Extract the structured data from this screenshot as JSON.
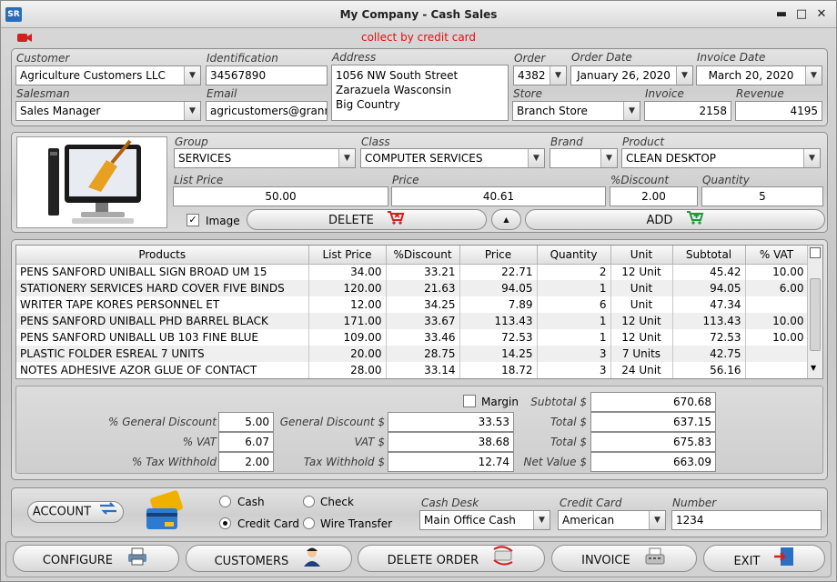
{
  "window": {
    "title": "My Company - Cash Sales",
    "logo_text": "SR",
    "min_glyph": "▬",
    "max_glyph": "□",
    "close_glyph": "✕"
  },
  "header": {
    "notice": "collect by credit card"
  },
  "customer": {
    "customer_label": "Customer",
    "customer_value": "Agriculture Customers LLC",
    "identification_label": "Identification",
    "identification_value": "34567890",
    "address_label": "Address",
    "address_lines": [
      "1056 NW South Street",
      "Zarazuela Wasconsin",
      "Big Country"
    ],
    "order_label": "Order",
    "order_value": "4382",
    "order_date_label": "Order Date",
    "order_date_value": "January 26, 2020",
    "invoice_date_label": "Invoice Date",
    "invoice_date_value": "March 20, 2020",
    "salesman_label": "Salesman",
    "salesman_value": "Sales Manager",
    "email_label": "Email",
    "email_value": "agricustomers@granm",
    "store_label": "Store",
    "store_value": "Branch Store",
    "invoice_label": "Invoice",
    "invoice_value": "2158",
    "revenue_label": "Revenue",
    "revenue_value": "4195"
  },
  "product": {
    "group_label": "Group",
    "group_value": "SERVICES",
    "class_label": "Class",
    "class_value": "COMPUTER SERVICES",
    "brand_label": "Brand",
    "brand_value": "",
    "product_label": "Product",
    "product_value": "CLEAN DESKTOP",
    "list_price_label": "List Price",
    "list_price_value": "50.00",
    "price_label": "Price",
    "price_value": "40.61",
    "discount_label": "%Discount",
    "discount_value": "2.00",
    "quantity_label": "Quantity",
    "quantity_value": "5",
    "image_checkbox_label": "Image",
    "image_checked": "✓",
    "delete_label": "DELETE",
    "up_glyph": "▲",
    "add_label": "ADD"
  },
  "grid": {
    "columns": [
      "Products",
      "List Price",
      "%Discount",
      "Price",
      "Quantity",
      "Unit",
      "Subtotal",
      "% VAT"
    ],
    "rows": [
      [
        "PENS SANFORD UNIBALL SIGN BROAD UM 15",
        "34.00",
        "33.21",
        "22.71",
        "2",
        "12 Unit",
        "45.42",
        "10.00"
      ],
      [
        "STATIONERY SERVICES HARD COVER FIVE BINDS",
        "120.00",
        "21.63",
        "94.05",
        "1",
        "Unit",
        "94.05",
        "6.00"
      ],
      [
        "WRITER TAPE KORES PERSONNEL ET",
        "12.00",
        "34.25",
        "7.89",
        "6",
        "Unit",
        "47.34",
        ""
      ],
      [
        "PENS SANFORD UNIBALL PHD BARREL BLACK",
        "171.00",
        "33.67",
        "113.43",
        "1",
        "12 Unit",
        "113.43",
        "10.00"
      ],
      [
        "PENS SANFORD UNIBALL UB 103 FINE BLUE",
        "109.00",
        "33.46",
        "72.53",
        "1",
        "12 Unit",
        "72.53",
        "10.00"
      ],
      [
        "PLASTIC FOLDER ESREAL 7 UNITS",
        "20.00",
        "28.75",
        "14.25",
        "3",
        "7 Units",
        "42.75",
        ""
      ],
      [
        "NOTES ADHESIVE AZOR GLUE OF CONTACT",
        "28.00",
        "33.14",
        "18.72",
        "3",
        "24 Unit",
        "56.16",
        ""
      ]
    ]
  },
  "totals": {
    "margin_label": "Margin",
    "general_discount_pct_label": "% General Discount",
    "general_discount_pct_value": "5.00",
    "vat_pct_label": "% VAT",
    "vat_pct_value": "6.07",
    "tax_withhold_pct_label": "% Tax Withhold",
    "tax_withhold_pct_value": "2.00",
    "general_discount_amt_label": "General Discount $",
    "general_discount_amt_value": "33.53",
    "vat_amt_label": "VAT $",
    "vat_amt_value": "38.68",
    "tax_withhold_amt_label": "Tax Withhold $",
    "tax_withhold_amt_value": "12.74",
    "subtotal_label": "Subtotal $",
    "subtotal_value": "670.68",
    "total1_label": "Total $",
    "total1_value": "637.15",
    "total2_label": "Total $",
    "total2_value": "675.83",
    "net_value_label": "Net Value $",
    "net_value_value": "663.09"
  },
  "payment": {
    "account_label": "ACCOUNT",
    "cash_label": "Cash",
    "check_label": "Check",
    "credit_card_label": "Credit Card",
    "wire_transfer_label": "Wire Transfer",
    "cash_desk_label": "Cash Desk",
    "cash_desk_value": "Main Office Cash",
    "credit_card_field_label": "Credit Card",
    "credit_card_value": "American",
    "number_label": "Number",
    "number_value": "1234"
  },
  "footer": {
    "configure_label": "CONFIGURE",
    "customers_label": "CUSTOMERS",
    "delete_order_label": "DELETE ORDER",
    "invoice_label": "INVOICE",
    "exit_label": "EXIT"
  },
  "colors": {
    "notice_red": "#e01010",
    "cart_red": "#d02020",
    "cart_green": "#1a9a3a",
    "panel_border": "#8c8c8c"
  }
}
